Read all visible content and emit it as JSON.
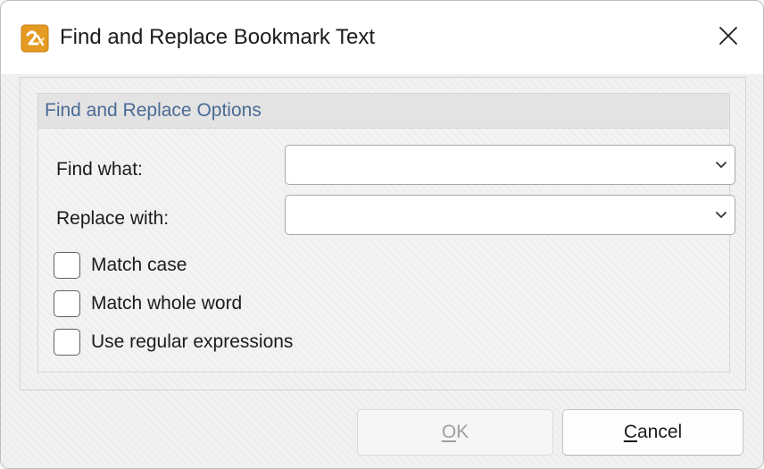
{
  "dialog": {
    "title": "Find and Replace Bookmark Text",
    "app_icon": "app-logo-icon",
    "close_icon": "close-icon"
  },
  "options": {
    "group_title": "Find and Replace Options",
    "find_label": "Find what:",
    "find_value": "",
    "replace_label": "Replace with:",
    "replace_value": "",
    "checkboxes": [
      {
        "label": "Match case",
        "checked": false
      },
      {
        "label": "Match whole word",
        "checked": false
      },
      {
        "label": "Use regular expressions",
        "checked": false
      }
    ]
  },
  "buttons": {
    "ok_mnemonic": "O",
    "ok_rest": "K",
    "ok_enabled": false,
    "cancel_mnemonic": "C",
    "cancel_rest": "ancel"
  },
  "colors": {
    "group_title": "#4a6b96",
    "app_icon_orange": "#e59a21",
    "disabled_text": "#9f9f9f"
  }
}
